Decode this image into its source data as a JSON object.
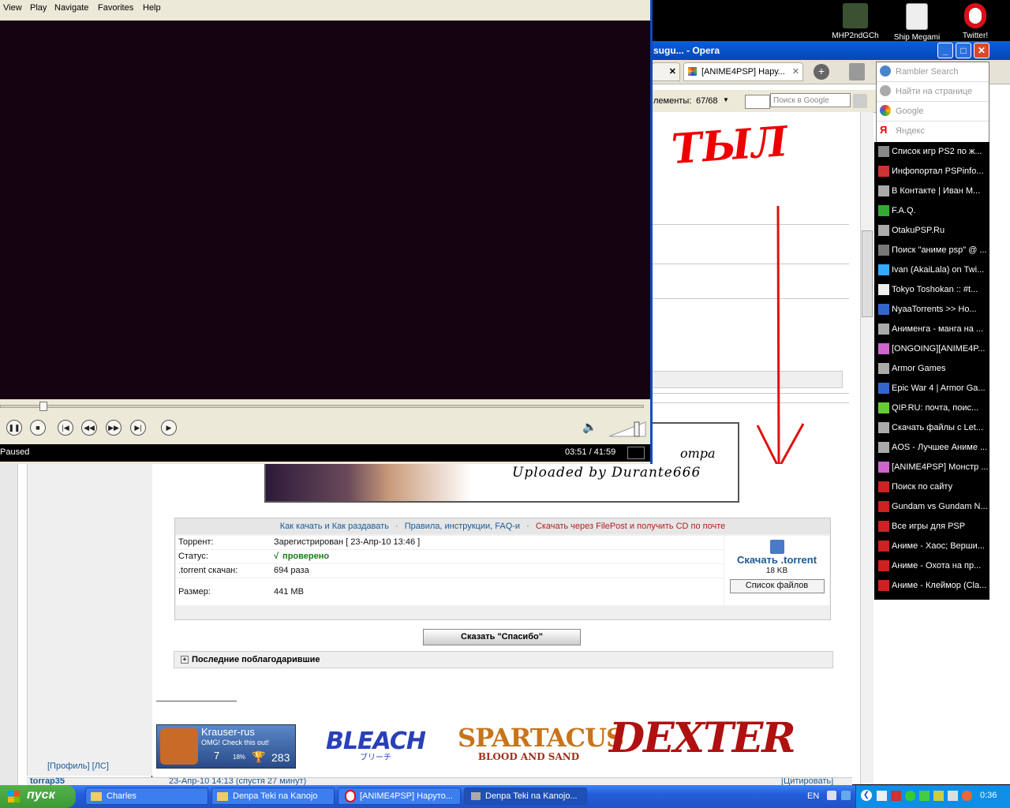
{
  "desktop": {
    "icons": [
      {
        "label": "MHP2ndGCh"
      },
      {
        "label": "Ship Megami"
      },
      {
        "label": "Twitter!"
      }
    ]
  },
  "opera": {
    "title": "sugu... - Opera",
    "tabs": [
      {
        "label": ""
      },
      {
        "label": "[ANIME4PSP] Нару..."
      }
    ],
    "toolbar": {
      "elements_label": "лементы:",
      "elements_count": "67/68",
      "search_placeholder": "Поиск в Google"
    },
    "search_dropdown": [
      {
        "label": "Rambler Search"
      },
      {
        "label": "Найти на странице"
      },
      {
        "label": "Google"
      },
      {
        "label": "Яндекс"
      }
    ],
    "bookmarks": [
      {
        "label": "Список игр PS2 по ж..."
      },
      {
        "label": "Инфопортал PSPinfo..."
      },
      {
        "label": "В Контакте | Иван М..."
      },
      {
        "label": "F.A.Q."
      },
      {
        "label": "OtakuPSP.Ru"
      },
      {
        "label": "Поиск \"аниме psp\" @ ..."
      },
      {
        "label": "Ivan (AkaiLala) on Twi..."
      },
      {
        "label": "Tokyo Toshokan :: #t..."
      },
      {
        "label": "NyaaTorrents >> Ho..."
      },
      {
        "label": "Анименга - манга на ..."
      },
      {
        "label": "[ONGOING][ANIME4P..."
      },
      {
        "label": "Armor Games"
      },
      {
        "label": "Epic War 4 | Armor Ga..."
      },
      {
        "label": "QIP.RU: почта, поис..."
      },
      {
        "label": "Скачать файлы с Let..."
      },
      {
        "label": "AOS - Лучшее Аниме ..."
      },
      {
        "label": "[ANIME4PSP] Монстр ..."
      },
      {
        "label": "Поиск по сайту"
      },
      {
        "label": "Gundam vs Gundam N..."
      },
      {
        "label": "Все игры для PSP"
      },
      {
        "label": "Аниме - Хаос; Верши..."
      },
      {
        "label": "Аниме - Охота на пр..."
      },
      {
        "label": "Аниме - Клеймор (Cla..."
      }
    ],
    "page": {
      "banner_line1": "ompa",
      "banner_line2": "Uploaded by Durante666",
      "links": {
        "how_to": "Как качать и Как раздавать",
        "sep1": "·",
        "rules": "Правила, инструкции, FAQ-и",
        "sep2": "·",
        "filepost": "Скачать через FilePost и получить CD по почте"
      },
      "torrent_rows": [
        {
          "key": "Торрент:",
          "value": "Зарегистрирован  [ 23-Апр-10 13:46 ]"
        },
        {
          "key": "Статус:",
          "value": "проверено"
        },
        {
          "key": ".torrent скачан:",
          "value": "694 раза"
        },
        {
          "key": "Размер:",
          "value": "441 MB"
        }
      ],
      "status_check": "√",
      "download_label": "Скачать .torrent",
      "download_size": "18 KB",
      "file_list_button": "Список файлов",
      "thanks_button": "Сказать \"Спасибо\"",
      "thanked_header": "Последние поблагодарившие",
      "thanked_toggle": "+",
      "profile_links": "[Профиль]  [ЛС]",
      "sig_card": {
        "name": "Krauser-rus",
        "tagline": "OMG! Check this out!",
        "level": "7",
        "percent": "18%",
        "trophies": "283"
      },
      "sig_logos": {
        "bleach": "BLEACH",
        "bleach_sub": "ブリーチ",
        "spartacus": "SPARTACUS",
        "spartacus_sub": "BLOOD AND SAND",
        "dexter": "DEXTER"
      },
      "next_post_author": "torrap35",
      "next_post_meta": "23-Апр-10 14:13  (спустя 27 минут)",
      "quote_button": "[Цитировать]"
    }
  },
  "media_player": {
    "menu": [
      "View",
      "Play",
      "Navigate",
      "Favorites",
      "Help"
    ],
    "status": "Paused",
    "time": "03:51 / 41:59",
    "seek_progress": 0.066,
    "volume": 0.8
  },
  "taskbar": {
    "start": "пуск",
    "buttons": [
      {
        "label": "Charles"
      },
      {
        "label": "Denpa Teki na Kanojo"
      },
      {
        "label": "[ANIME4PSP] Наруто..."
      },
      {
        "label": "Denpa Teki na Kanojo..."
      }
    ],
    "lang": "EN",
    "clock": "0:36"
  },
  "colors": {
    "link_blue": "#1a5a96",
    "link_red": "#b32020",
    "status_green": "#1a7a1a",
    "xp_blue": "#245edc",
    "annotation_red": "#e01010"
  }
}
